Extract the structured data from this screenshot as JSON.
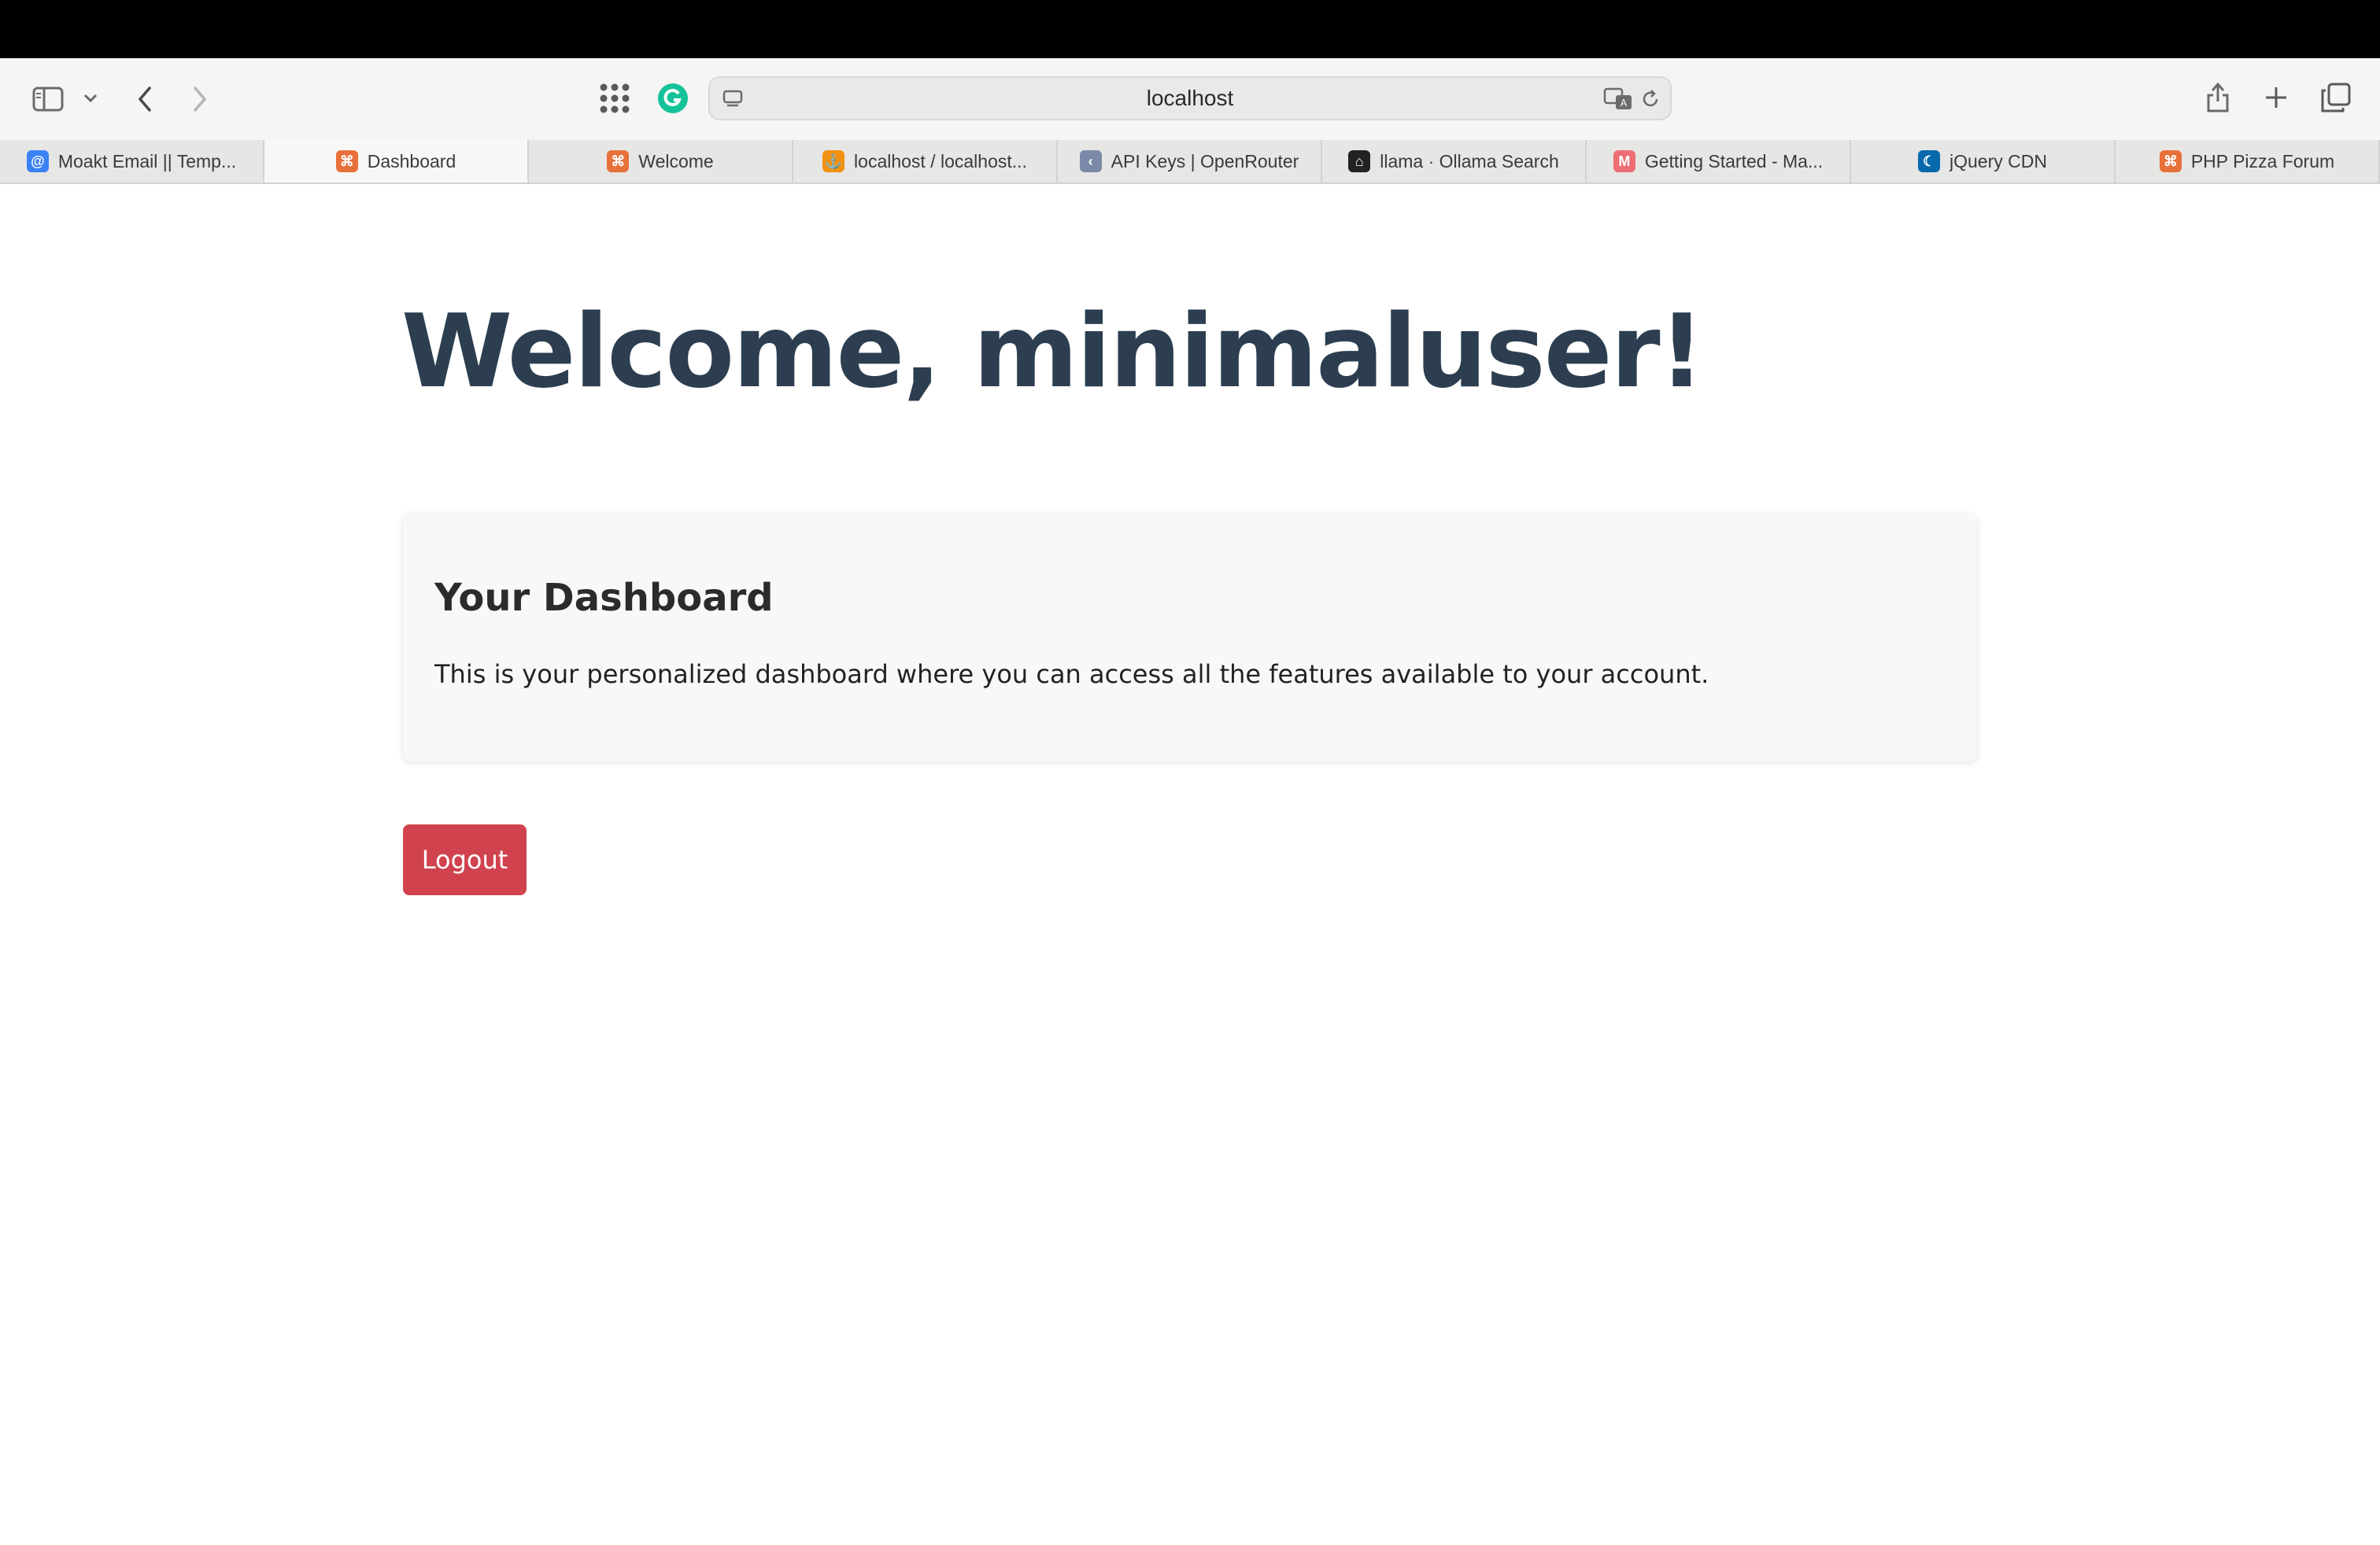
{
  "browser": {
    "address": "localhost",
    "tabs": [
      {
        "label": "Moakt Email || Temp...",
        "icon": "at-icon",
        "color": "#3b82f6"
      },
      {
        "label": "Dashboard",
        "icon": "xampp-icon",
        "color": "#e8703a",
        "active": true
      },
      {
        "label": "Welcome",
        "icon": "xampp-icon",
        "color": "#e8703a"
      },
      {
        "label": "localhost / localhost...",
        "icon": "phpmyadmin-icon",
        "color": "#f29111"
      },
      {
        "label": "API Keys | OpenRouter",
        "icon": "openrouter-icon",
        "color": "#7b8aa8"
      },
      {
        "label": "llama · Ollama Search",
        "icon": "ollama-icon",
        "color": "#222222"
      },
      {
        "label": "Getting Started - Ma...",
        "icon": "materialize-icon",
        "color": "#ee6e73"
      },
      {
        "label": "jQuery CDN",
        "icon": "jquery-icon",
        "color": "#0769ad"
      },
      {
        "label": "PHP Pizza Forum",
        "icon": "xampp-icon",
        "color": "#e8703a"
      }
    ]
  },
  "page": {
    "welcome": "Welcome, minimaluser!",
    "card_title": "Your Dashboard",
    "card_text": "This is your personalized dashboard where you can access all the features available to your account.",
    "logout_label": "Logout"
  },
  "colors": {
    "heading": "#2c3e50",
    "logout_bg": "#d0434e",
    "card_bg": "#f7f8f9"
  }
}
